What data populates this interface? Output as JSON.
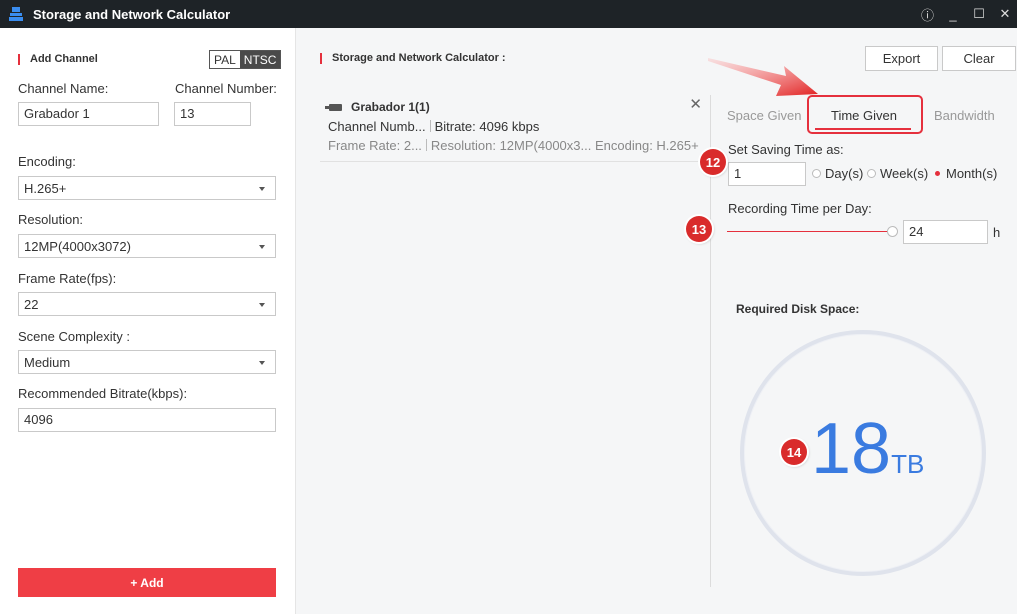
{
  "window": {
    "title": "Storage and Network Calculator",
    "controls": {
      "info": "ⓘ",
      "minimize": "_",
      "maximize": "☐",
      "close": "✕"
    }
  },
  "add_channel": {
    "heading": "Add Channel",
    "pal_label": "PAL",
    "ntsc_label": "NTSC",
    "channel_name_label": "Channel Name:",
    "channel_name_value": "Grabador 1",
    "channel_number_label": "Channel Number:",
    "channel_number_value": "13",
    "encoding_label": "Encoding:",
    "encoding_value": "H.265+",
    "resolution_label": "Resolution:",
    "resolution_value": "12MP(4000x3072)",
    "frame_rate_label": "Frame Rate(fps):",
    "frame_rate_value": "22",
    "scene_label": "Scene Complexity :",
    "scene_value": "Medium",
    "bitrate_label": "Recommended Bitrate(kbps):",
    "bitrate_value": "4096",
    "add_button": "+ Add"
  },
  "calculator": {
    "heading": "Storage and Network Calculator :",
    "export_button": "Export",
    "clear_button": "Clear",
    "channel": {
      "name": "Grabador 1(1)",
      "line1_a": "Channel Numb...",
      "line1_b": "Bitrate: 4096 kbps",
      "line2_a": "Frame Rate: 2...",
      "line2_b": "Resolution: 12MP(4000x3...",
      "line2_c": "Encoding: H.265+",
      "close": "✕"
    },
    "tabs": [
      "Space Given",
      "Time Given",
      "Bandwidth"
    ],
    "saving_time_label": "Set Saving Time as:",
    "saving_time_value": "1",
    "unit_options": [
      "Day(s)",
      "Week(s)",
      "Month(s)"
    ],
    "selected_unit": "Month(s)",
    "recording_label": "Recording Time per Day:",
    "recording_value": "24",
    "recording_unit": "h",
    "recording_fraction": 1.0,
    "disk_label": "Required Disk Space:",
    "disk_value": "18",
    "disk_unit": "TB"
  },
  "annotations": {
    "badge_12": "12",
    "badge_13": "13",
    "badge_14": "14"
  },
  "colors": {
    "accent": "#e5303d",
    "result_blue": "#3a7be0",
    "titlebar": "#1e2327"
  }
}
